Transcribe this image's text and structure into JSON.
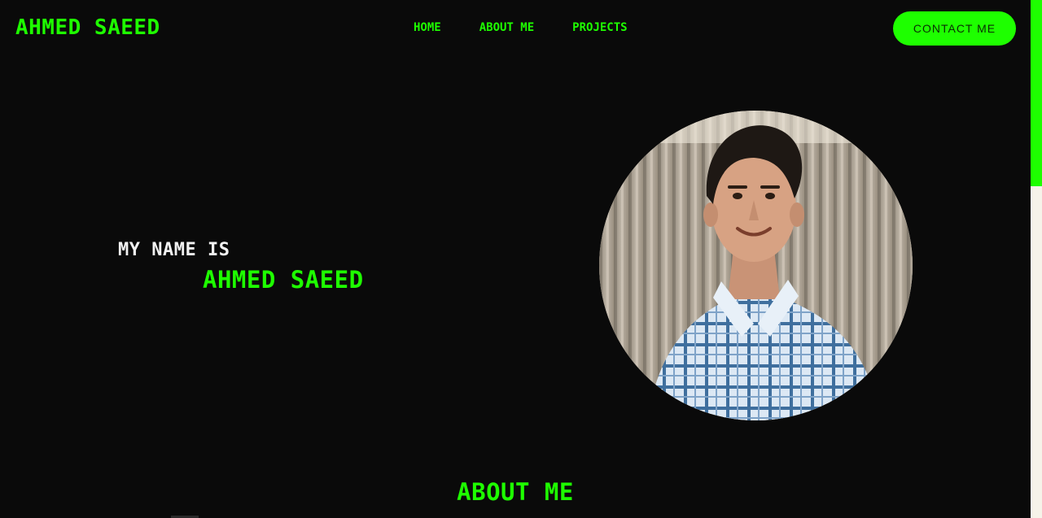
{
  "header": {
    "brand": "AHMED SAEED",
    "nav": [
      {
        "label": "HOME"
      },
      {
        "label": "ABOUT ME"
      },
      {
        "label": "PROJECTS"
      }
    ],
    "contact_label": "CONTACT ME"
  },
  "hero": {
    "intro": "MY NAME IS",
    "name": "AHMED SAEED",
    "portrait_icon": "profile-photo"
  },
  "about": {
    "heading": "ABOUT ME"
  },
  "colors": {
    "background": "#0a0a0a",
    "accent": "#1eff00",
    "text": "#f2f2f2",
    "scrollbar_track": "#f6f3e9"
  }
}
